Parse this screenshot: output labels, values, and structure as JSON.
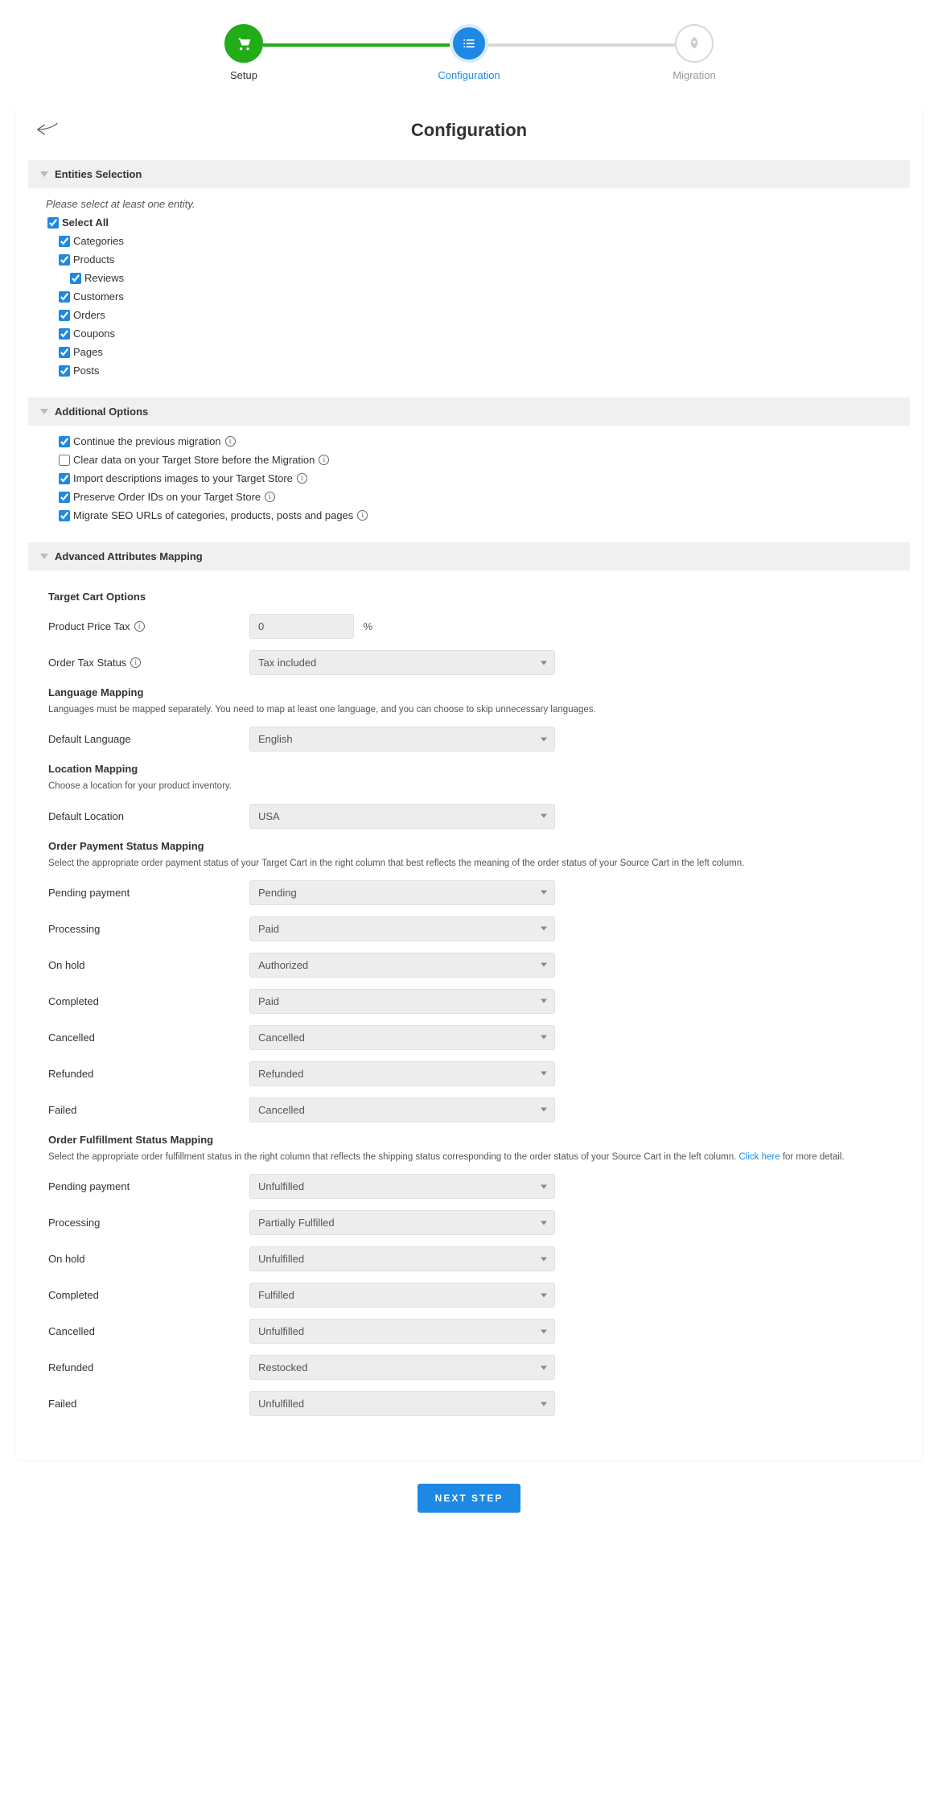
{
  "stepper": {
    "steps": [
      {
        "label": "Setup",
        "state": "done"
      },
      {
        "label": "Configuration",
        "state": "active"
      },
      {
        "label": "Migration",
        "state": "pending"
      }
    ]
  },
  "page": {
    "title": "Configuration"
  },
  "sections": {
    "entities": {
      "title": "Entities Selection",
      "hint": "Please select at least one entity.",
      "selectAll": "Select All",
      "items": [
        "Categories",
        "Products",
        "Reviews",
        "Customers",
        "Orders",
        "Coupons",
        "Pages",
        "Posts"
      ]
    },
    "options": {
      "title": "Additional Options",
      "items": [
        {
          "label": "Continue the previous migration",
          "checked": true,
          "info": true
        },
        {
          "label": "Clear data on your Target Store before the Migration",
          "checked": false,
          "info": true
        },
        {
          "label": "Import descriptions images to your Target Store",
          "checked": true,
          "info": true
        },
        {
          "label": "Preserve Order IDs on your Target Store",
          "checked": true,
          "info": true
        },
        {
          "label": "Migrate SEO URLs of categories, products, posts and pages",
          "checked": true,
          "info": true
        }
      ]
    },
    "mapping": {
      "title": "Advanced Attributes Mapping",
      "targetCart": {
        "title": "Target Cart Options",
        "priceTaxLabel": "Product Price Tax",
        "priceTaxValue": "0",
        "pct": "%",
        "orderTaxLabel": "Order Tax Status",
        "orderTaxValue": "Tax included"
      },
      "language": {
        "title": "Language Mapping",
        "desc": "Languages must be mapped separately. You need to map at least one language, and you can choose to skip unnecessary languages.",
        "defaultLabel": "Default Language",
        "defaultValue": "English"
      },
      "location": {
        "title": "Location Mapping",
        "desc": "Choose a location for your product inventory.",
        "defaultLabel": "Default Location",
        "defaultValue": "USA"
      },
      "payment": {
        "title": "Order Payment Status Mapping",
        "desc": "Select the appropriate order payment status of your Target Cart in the right column that best reflects the meaning of the order status of your Source Cart in the left column.",
        "rows": [
          {
            "label": "Pending payment",
            "value": "Pending"
          },
          {
            "label": "Processing",
            "value": "Paid"
          },
          {
            "label": "On hold",
            "value": "Authorized"
          },
          {
            "label": "Completed",
            "value": "Paid"
          },
          {
            "label": "Cancelled",
            "value": "Cancelled"
          },
          {
            "label": "Refunded",
            "value": "Refunded"
          },
          {
            "label": "Failed",
            "value": "Cancelled"
          }
        ]
      },
      "fulfillment": {
        "title": "Order Fulfillment Status Mapping",
        "desc1": "Select the appropriate order fulfillment status in the right column that reflects the shipping status corresponding to the order status of your Source Cart in the left column. ",
        "link": "Click here",
        "desc2": " for more detail.",
        "rows": [
          {
            "label": "Pending payment",
            "value": "Unfulfilled"
          },
          {
            "label": "Processing",
            "value": "Partially Fulfilled"
          },
          {
            "label": "On hold",
            "value": "Unfulfilled"
          },
          {
            "label": "Completed",
            "value": "Fulfilled"
          },
          {
            "label": "Cancelled",
            "value": "Unfulfilled"
          },
          {
            "label": "Refunded",
            "value": "Restocked"
          },
          {
            "label": "Failed",
            "value": "Unfulfilled"
          }
        ]
      }
    }
  },
  "button": {
    "next": "NEXT STEP"
  }
}
